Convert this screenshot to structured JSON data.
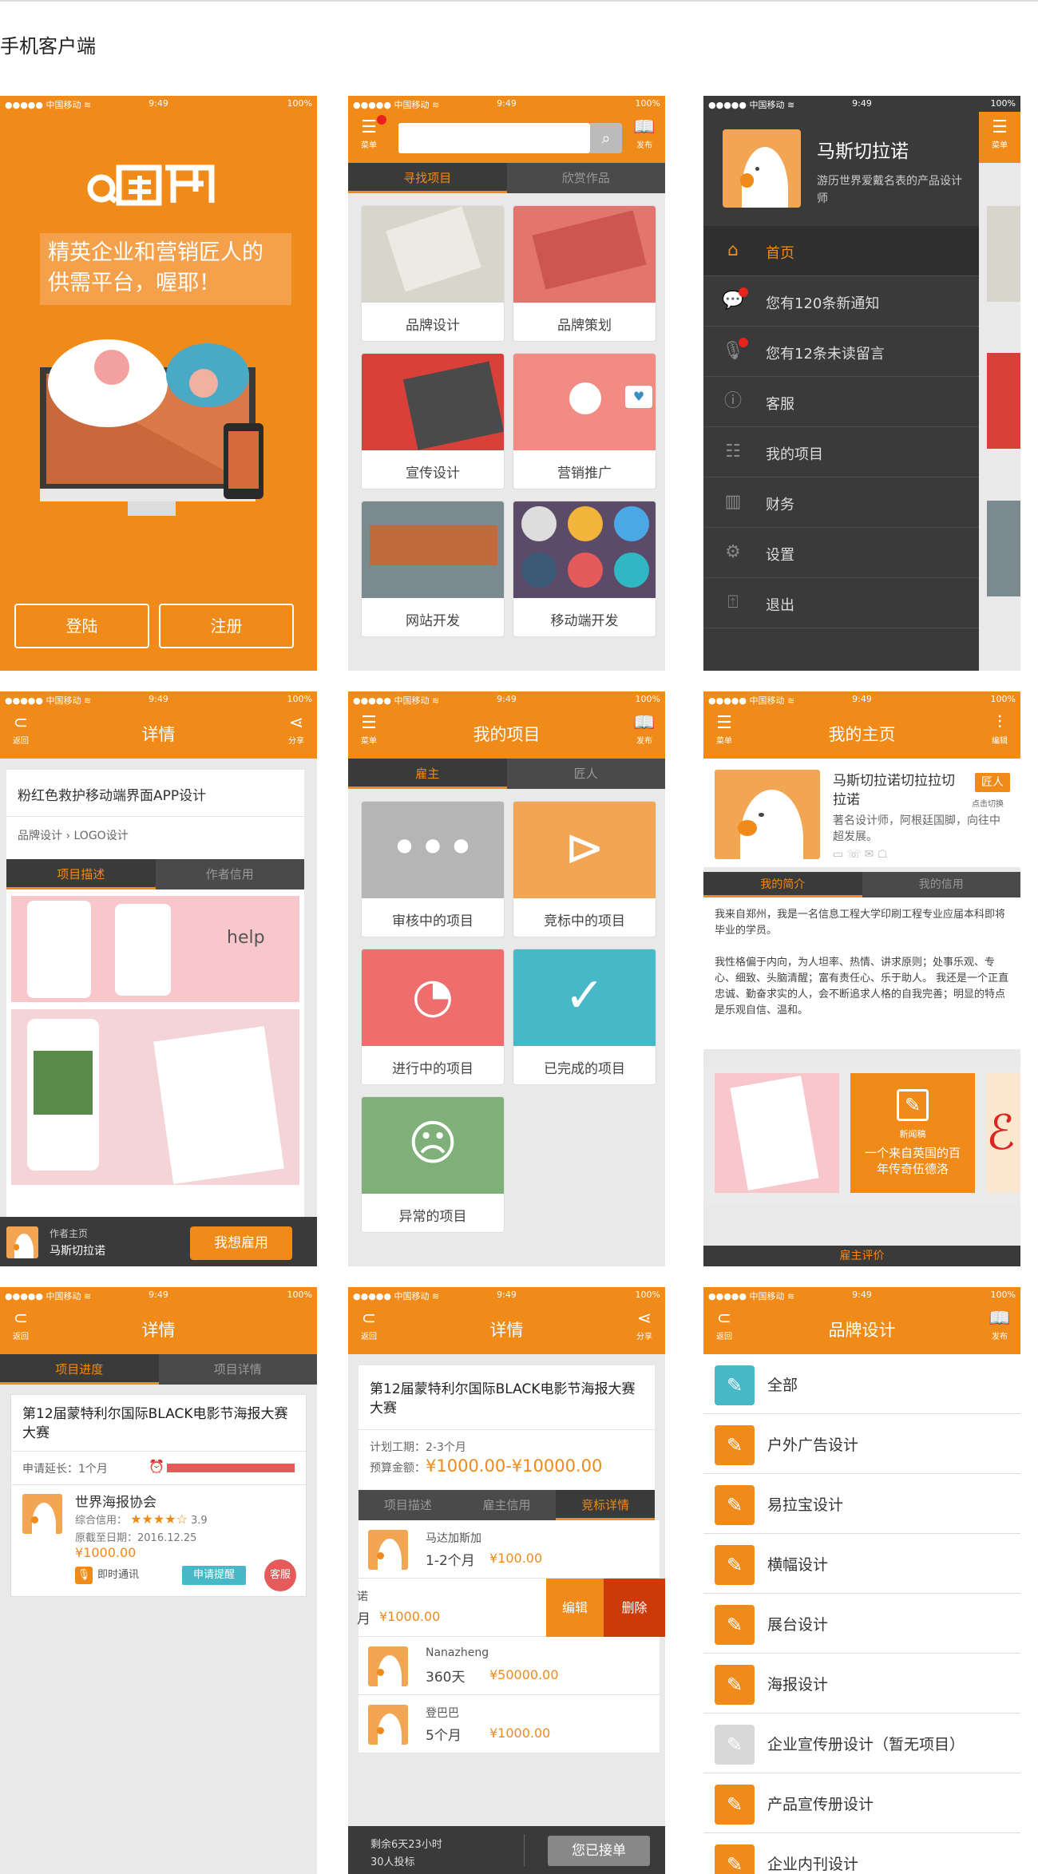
{
  "page_title": "手机客户端",
  "status": {
    "carrier": "●●●●● 中国移动 ≋",
    "time": "9:49",
    "battery": "100%"
  },
  "s1": {
    "slogan": "精英企业和营销匠人的供需平台，喔耶！",
    "login": "登陆",
    "register": "注册"
  },
  "s2": {
    "menu": "菜单",
    "publish": "发布",
    "tabs": [
      "寻找项目",
      "欣赏作品"
    ],
    "cards": [
      "品牌设计",
      "品牌策划",
      "宣传设计",
      "营销推广",
      "网站开发",
      "移动端开发"
    ]
  },
  "s3": {
    "menu": "菜单",
    "user_name": "马斯切拉诺",
    "user_desc": "游历世界爱戴名表的产品设计师",
    "items": [
      "首页",
      "您有120条新通知",
      "您有12条未读留言",
      "客服",
      "我的项目",
      "财务",
      "设置",
      "退出"
    ]
  },
  "s4": {
    "back": "返回",
    "title": "详情",
    "share": "分享",
    "project_title": "粉红色救护移动端界面APP设计",
    "crumb1": "品牌设计",
    "crumb2": "LOGO设计",
    "tabs": [
      "项目描述",
      "作者信用"
    ],
    "help": "help",
    "author_label": "作者主页",
    "author_name": "马斯切拉诺",
    "hire": "我想雇用"
  },
  "s5": {
    "menu": "菜单",
    "title": "我的项目",
    "publish": "发布",
    "tabs": [
      "雇主",
      "匠人"
    ],
    "tiles": [
      "审核中的项目",
      "竞标中的项目",
      "进行中的项目",
      "已完成的项目",
      "异常的项目"
    ]
  },
  "s6": {
    "menu": "菜单",
    "title": "我的主页",
    "edit": "编辑",
    "name": "马斯切拉诺切拉拉切拉诺",
    "badge": "匠人",
    "badge_sub": "点击切换",
    "desc": "著名设计师，阿根廷国脚，向往中超发展。",
    "tabs": [
      "我的简介",
      "我的信用"
    ],
    "p1": "我来自郑州，我是一名信息工程大学印刷工程专业应届本科即将毕业的学员。",
    "p2": "我性格偏于内向，为人坦率、热情、讲求原则；处事乐观、专心、细致、头脑清醒；富有责任心、乐于助人。 我还是一个正直忠诚、勤奋求实的人，会不断追求人格的自我完善；明显的特点是乐观自信、温和。",
    "news_tag": "新闻稿",
    "news_text": "一个来自英国的百年传奇伍德洛",
    "bottom": "雇主评价"
  },
  "s7": {
    "back": "返回",
    "title": "详情",
    "tabs": [
      "项目进度",
      "项目详情"
    ],
    "project": "第12届蒙特利尔国际BLACK电影节海报大赛大赛",
    "apply": "申请延长：1个月",
    "org": "世界海报协会",
    "credit_label": "综合信用：",
    "rating": 3.9,
    "rating_text": "3.9",
    "deadline": "原截至日期：2016.12.25",
    "price": "¥1000.00",
    "chat": "即时通讯",
    "remind": "申请提醒",
    "service": "客服"
  },
  "s8": {
    "back": "返回",
    "title": "详情",
    "share": "分享",
    "project": "第12届蒙特利尔国际BLACK电影节海报大赛大赛",
    "plan": "计划工期：2-3个月",
    "budget_label": "预算金额：",
    "budget": "¥1000.00-¥10000.00",
    "tabs": [
      "项目描述",
      "雇主信用",
      "竞标详情"
    ],
    "bids": [
      {
        "name": "马达加斯加",
        "time": "1-2个月",
        "price": "¥100.00"
      },
      {
        "name": "诺",
        "time": "月",
        "price": "¥1000.00"
      },
      {
        "name": "Nanazheng",
        "time": "360天",
        "price": "¥50000.00"
      },
      {
        "name": "登巴巴",
        "time": "5个月",
        "price": "¥1000.00"
      }
    ],
    "edit": "编辑",
    "delete": "删除",
    "remain": "剩余6天23小时",
    "bidders": "30人投标",
    "accepted": "您已接单"
  },
  "s9": {
    "back": "返回",
    "title": "品牌设计",
    "publish": "发布",
    "items": [
      "全部",
      "户外广告设计",
      "易拉宝设计",
      "横幅设计",
      "展台设计",
      "海报设计",
      "企业宣传册设计（暂无项目）",
      "产品宣传册设计",
      "企业内刊设计"
    ]
  },
  "colors": {
    "accent": "#f08a18",
    "dark": "#3a3a3a",
    "red": "#e55a5a"
  }
}
